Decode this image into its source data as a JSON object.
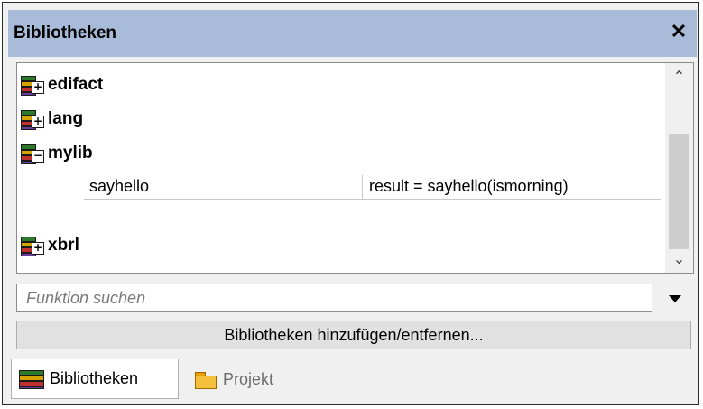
{
  "panel": {
    "title": "Bibliotheken",
    "close_glyph": "✕"
  },
  "libraries": [
    {
      "name": "edifact",
      "state": "collapsed",
      "expander_glyph": "+"
    },
    {
      "name": "lang",
      "state": "collapsed",
      "expander_glyph": "+"
    },
    {
      "name": "mylib",
      "state": "expanded",
      "expander_glyph": "−",
      "functions": [
        {
          "name": "sayhello",
          "signature": "result = sayhello(ismorning)"
        }
      ]
    },
    {
      "name": "xbrl",
      "state": "collapsed",
      "expander_glyph": "+"
    }
  ],
  "scrollbar": {
    "up_glyph": "⌃",
    "down_glyph": "⌄"
  },
  "search": {
    "value": "",
    "placeholder": "Funktion suchen"
  },
  "add_remove_button": "Bibliotheken hinzufügen/entfernen...",
  "tabs": [
    {
      "label": "Bibliotheken",
      "icon": "books-icon",
      "active": true
    },
    {
      "label": "Projekt",
      "icon": "folder-icon",
      "active": false
    }
  ],
  "colors": {
    "titlebar": "#a8bbd8",
    "panel_bg": "#f0f0f0",
    "inactive_tab_text": "#6d6d6d"
  }
}
